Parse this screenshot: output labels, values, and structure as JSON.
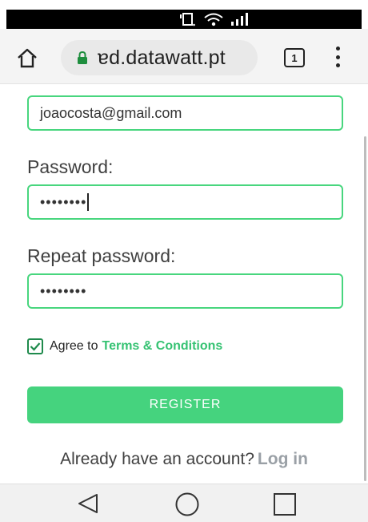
{
  "browser": {
    "url": "ɐd.datawatt.pt",
    "tab_count": "1"
  },
  "form": {
    "email_value": "joaocosta@gmail.com",
    "password_label": "Password:",
    "password_value": "••••••••",
    "repeat_password_label": "Repeat password:",
    "repeat_password_value": "••••••••",
    "agree_prefix": "Agree to",
    "terms_link": "Terms & Conditions",
    "agree_checked": true,
    "register_label": "REGISTER",
    "already_text": "Already have an account?",
    "login_link": "Log in"
  },
  "colors": {
    "accent": "#45d37e",
    "link": "#35c272",
    "muted_link": "#9aa0a6"
  },
  "icons": {
    "status": [
      "vibrate-icon",
      "wifi-icon",
      "signal-icon"
    ],
    "toolbar": [
      "home-icon",
      "lock-icon",
      "tabs-icon",
      "menu-icon"
    ],
    "nav": [
      "back-icon",
      "home-circle-icon",
      "recents-icon"
    ]
  }
}
